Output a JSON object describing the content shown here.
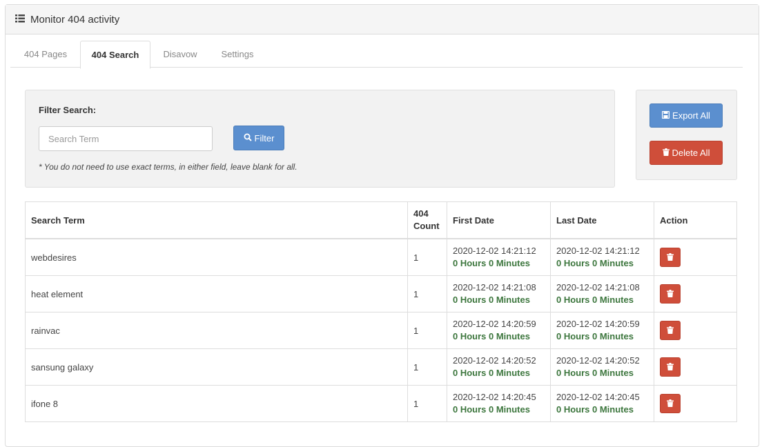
{
  "header": {
    "title": "Monitor 404 activity",
    "icon": "list-icon"
  },
  "tabs": [
    {
      "label": "404 Pages"
    },
    {
      "label": "404 Search"
    },
    {
      "label": "Disavow"
    },
    {
      "label": "Settings"
    }
  ],
  "filter": {
    "label": "Filter Search:",
    "placeholder": "Search Term",
    "button": "Filter",
    "note": "* You do not need to use exact terms, in either field, leave blank for all."
  },
  "actions": {
    "export": "Export All",
    "delete": "Delete All"
  },
  "table": {
    "headers": {
      "term": "Search Term",
      "count_1": "404",
      "count_2": "Count",
      "first": "First Date",
      "last": "Last Date",
      "action": "Action"
    },
    "rows": [
      {
        "term": "webdesires",
        "count": "1",
        "first": "2020-12-02 14:21:12",
        "first_ago": "0 Hours 0 Minutes",
        "last": "2020-12-02 14:21:12",
        "last_ago": "0 Hours 0 Minutes"
      },
      {
        "term": "heat element",
        "count": "1",
        "first": "2020-12-02 14:21:08",
        "first_ago": "0 Hours 0 Minutes",
        "last": "2020-12-02 14:21:08",
        "last_ago": "0 Hours 0 Minutes"
      },
      {
        "term": "rainvac",
        "count": "1",
        "first": "2020-12-02 14:20:59",
        "first_ago": "0 Hours 0 Minutes",
        "last": "2020-12-02 14:20:59",
        "last_ago": "0 Hours 0 Minutes"
      },
      {
        "term": "sansung galaxy",
        "count": "1",
        "first": "2020-12-02 14:20:52",
        "first_ago": "0 Hours 0 Minutes",
        "last": "2020-12-02 14:20:52",
        "last_ago": "0 Hours 0 Minutes"
      },
      {
        "term": "ifone 8",
        "count": "1",
        "first": "2020-12-02 14:20:45",
        "first_ago": "0 Hours 0 Minutes",
        "last": "2020-12-02 14:20:45",
        "last_ago": "0 Hours 0 Minutes"
      }
    ]
  },
  "colors": {
    "primary": "#5b8fcf",
    "danger": "#cf4e3a",
    "success_text": "#3c763d"
  }
}
